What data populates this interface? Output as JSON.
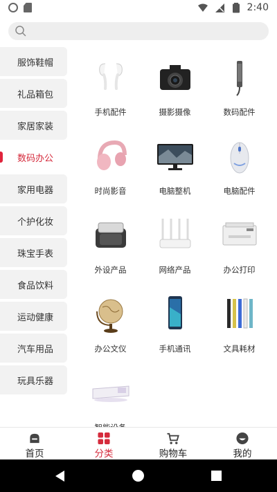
{
  "status_bar": {
    "time": "2:40"
  },
  "search": {
    "placeholder": ""
  },
  "sidebar": {
    "items": [
      {
        "label": "服饰鞋帽"
      },
      {
        "label": "礼品箱包"
      },
      {
        "label": "家居家装"
      },
      {
        "label": "数码办公",
        "active": true
      },
      {
        "label": "家用电器"
      },
      {
        "label": "个护化妆"
      },
      {
        "label": "珠宝手表"
      },
      {
        "label": "食品饮料"
      },
      {
        "label": "运动健康"
      },
      {
        "label": "汽车用品"
      },
      {
        "label": "玩具乐器"
      }
    ]
  },
  "categories": {
    "items": [
      {
        "label": "手机配件",
        "icon": "earphones-icon"
      },
      {
        "label": "摄影摄像",
        "icon": "camera-icon"
      },
      {
        "label": "数码配件",
        "icon": "stylus-icon"
      },
      {
        "label": "时尚影音",
        "icon": "headphones-icon"
      },
      {
        "label": "电脑整机",
        "icon": "monitor-icon"
      },
      {
        "label": "电脑配件",
        "icon": "mouse-icon"
      },
      {
        "label": "外设产品",
        "icon": "case-icon"
      },
      {
        "label": "网络产品",
        "icon": "router-icon"
      },
      {
        "label": "办公打印",
        "icon": "printer-icon"
      },
      {
        "label": "办公文仪",
        "icon": "globe-icon"
      },
      {
        "label": "手机通讯",
        "icon": "phone-icon"
      },
      {
        "label": "文具耗材",
        "icon": "pens-icon"
      },
      {
        "label": "智能设备",
        "icon": "projector-icon"
      }
    ]
  },
  "bottom_nav": {
    "items": [
      {
        "label": "首页",
        "icon": "home-icon"
      },
      {
        "label": "分类",
        "icon": "category-icon",
        "active": true
      },
      {
        "label": "购物车",
        "icon": "cart-icon"
      },
      {
        "label": "我的",
        "icon": "profile-icon"
      }
    ]
  },
  "colors": {
    "accent": "#d52b3c",
    "sidebar_bg": "#f2f2f2",
    "search_bg": "#eeeeee"
  }
}
